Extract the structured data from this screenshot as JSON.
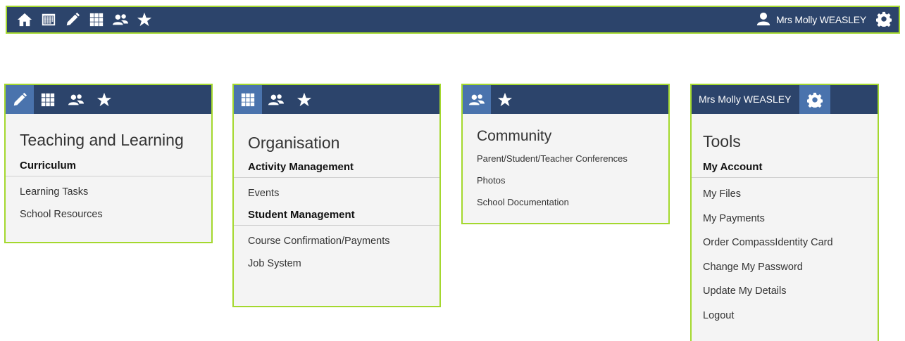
{
  "topbar": {
    "icons": [
      "home-icon",
      "calendar-icon",
      "pencil-icon",
      "grid-icon",
      "people-icon",
      "star-icon"
    ],
    "user_name": "Mrs Molly WEASLEY"
  },
  "panels": {
    "teaching": {
      "title": "Teaching and Learning",
      "sections": [
        {
          "heading": "Curriculum",
          "links": [
            "Learning Tasks",
            "School Resources"
          ]
        }
      ]
    },
    "organisation": {
      "title": "Organisation",
      "sections": [
        {
          "heading": "Activity Management",
          "links": [
            "Events"
          ]
        },
        {
          "heading": "Student Management",
          "links": [
            "Course Confirmation/Payments",
            "Job System"
          ]
        }
      ]
    },
    "community": {
      "title": "Community",
      "links": [
        "Parent/Student/Teacher Conferences",
        "Photos",
        "School Documentation"
      ]
    },
    "tools": {
      "user_name": "Mrs Molly WEASLEY",
      "title": "Tools",
      "sections": [
        {
          "heading": "My Account",
          "links": [
            "My Files",
            "My Payments",
            "Order CompassIdentity Card",
            "Change My Password",
            "Update My Details",
            "Logout"
          ]
        }
      ]
    }
  },
  "colors": {
    "bar": "#2c446b",
    "active": "#4a73ad",
    "border": "#a4d82e",
    "panel_bg": "#f4f4f4"
  }
}
